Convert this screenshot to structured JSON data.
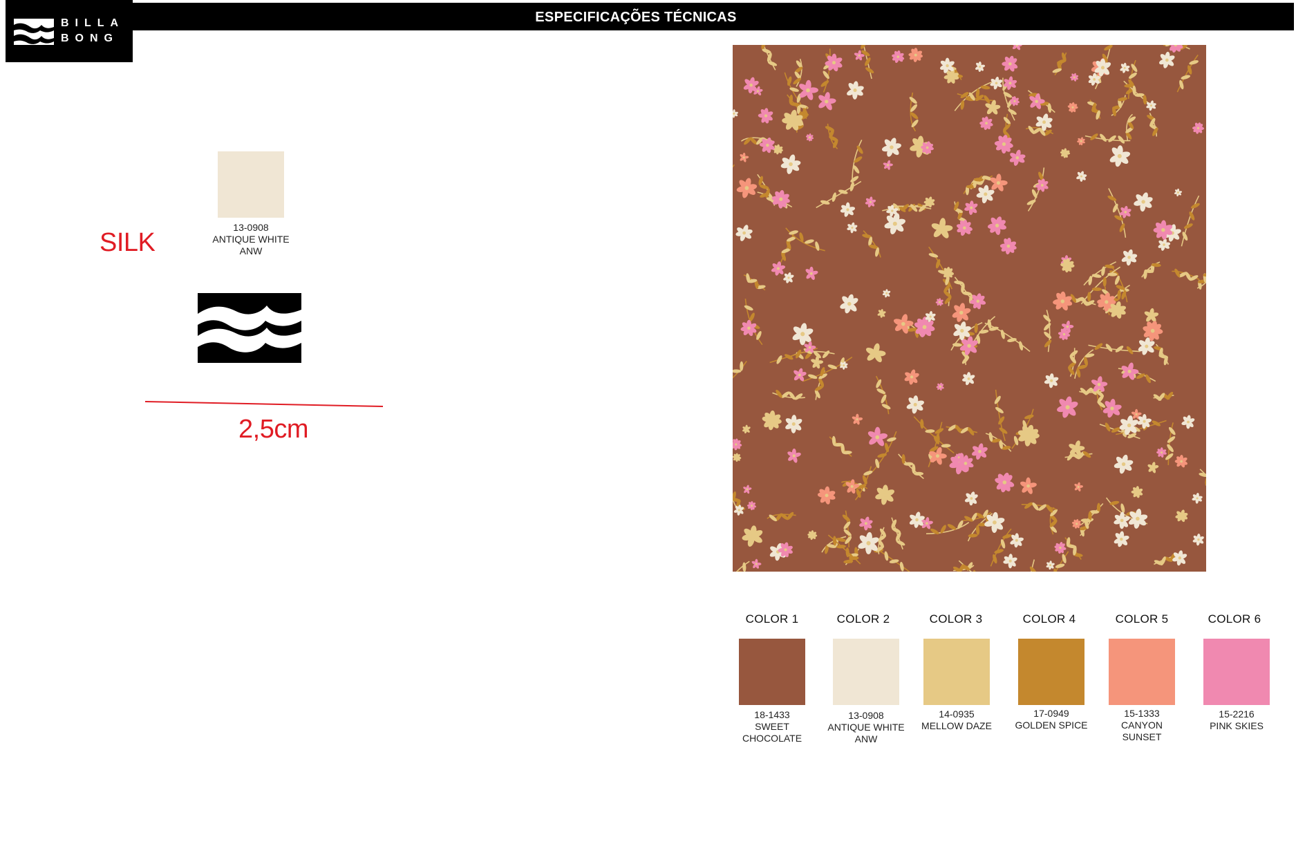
{
  "header": {
    "title": "ESPECIFICAÇÕES TÉCNICAS"
  },
  "brand": {
    "line1": "BILLA",
    "line2": "BONG"
  },
  "technique": {
    "label": "SILK"
  },
  "print_color": {
    "code": "13-0908",
    "name": "ANTIQUE WHITE",
    "abbr": "ANW",
    "hex": "#f0e6d4"
  },
  "measurement": {
    "label": "2,5cm"
  },
  "pattern": {
    "background": "#97573e"
  },
  "palette": [
    {
      "label": "COLOR 1",
      "code": "18-1433",
      "name_line1": "SWEET",
      "name_line2": "CHOCOLATE",
      "hex": "#97573e"
    },
    {
      "label": "COLOR 2",
      "code": "13-0908",
      "name_line1": "ANTIQUE WHITE",
      "name_line2": "ANW",
      "hex": "#f0e6d4"
    },
    {
      "label": "COLOR 3",
      "code": "14-0935",
      "name_line1": "MELLOW DAZE",
      "name_line2": "",
      "hex": "#e6c985"
    },
    {
      "label": "COLOR 4",
      "code": "17-0949",
      "name_line1": "GOLDEN SPICE",
      "name_line2": "",
      "hex": "#c4882e"
    },
    {
      "label": "COLOR 5",
      "code": "15-1333",
      "name_line1": "CANYON",
      "name_line2": "SUNSET",
      "hex": "#f5957b"
    },
    {
      "label": "COLOR 6",
      "code": "15-2216",
      "name_line1": "PINK SKIES",
      "name_line2": "",
      "hex": "#f089b0"
    }
  ]
}
